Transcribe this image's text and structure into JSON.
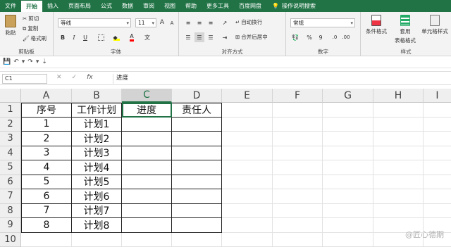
{
  "tabs": [
    "文件",
    "开始",
    "插入",
    "页面布局",
    "公式",
    "数据",
    "审阅",
    "视图",
    "帮助",
    "更多工具",
    "百度网盘"
  ],
  "active_tab": "开始",
  "search_label": "操作说明搜索",
  "clipboard": {
    "paste": "粘贴",
    "cut": "剪切",
    "copy": "复制",
    "format_painter": "格式刷",
    "label": "剪贴板"
  },
  "font": {
    "name": "等线",
    "size": "11",
    "label": "字体",
    "bold": "B",
    "italic": "I",
    "underline": "U",
    "grow": "A",
    "shrink": "A"
  },
  "alignment": {
    "wrap": "自动换行",
    "merge": "合并后居中",
    "label": "对齐方式"
  },
  "number": {
    "format": "常规",
    "percent": "%",
    "comma": "9",
    "label": "数字"
  },
  "styles": {
    "conditional": "条件格式",
    "table_format_line1": "套用",
    "table_format_line2": "表格格式",
    "cell_styles": "单元格样式",
    "label": "样式"
  },
  "formula_bar": {
    "name_box": "C1",
    "fx": "fx",
    "content": "进度"
  },
  "colors": {
    "accent": "#217346",
    "font_highlight": "#ffff00",
    "font_color": "#ff0000"
  },
  "columns": [
    "A",
    "B",
    "C",
    "D",
    "E",
    "F",
    "G",
    "H",
    "I"
  ],
  "rows": [
    "1",
    "2",
    "3",
    "4",
    "5",
    "6",
    "7",
    "8",
    "9",
    "10"
  ],
  "table": {
    "header": [
      "序号",
      "工作计划",
      "进度",
      "责任人"
    ],
    "body": [
      [
        "1",
        "计划1",
        "",
        ""
      ],
      [
        "2",
        "计划2",
        "",
        ""
      ],
      [
        "3",
        "计划3",
        "",
        ""
      ],
      [
        "4",
        "计划4",
        "",
        ""
      ],
      [
        "5",
        "计划5",
        "",
        ""
      ],
      [
        "6",
        "计划6",
        "",
        ""
      ],
      [
        "7",
        "计划7",
        "",
        ""
      ],
      [
        "8",
        "计划8",
        "",
        ""
      ]
    ]
  },
  "selected_cell": "C1",
  "watermark": "@匠心德期"
}
